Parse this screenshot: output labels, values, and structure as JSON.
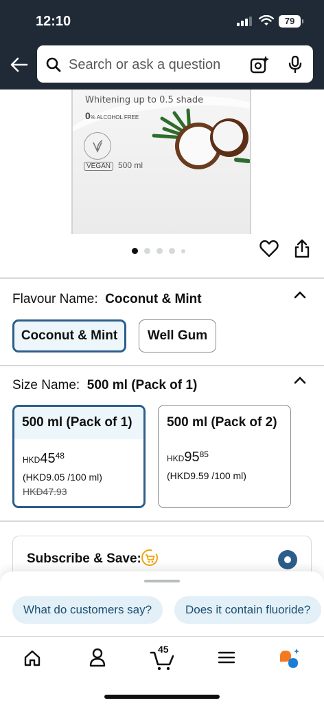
{
  "status_bar": {
    "time": "12:10",
    "battery": "79"
  },
  "search": {
    "placeholder": "Search or ask a question"
  },
  "product_image": {
    "bottle_text": "Whitening up to 0.5 shade",
    "alcohol_free_number": "0",
    "alcohol_free_label": "% ALCOHOL FREE",
    "vegan_badge": "VEGAN",
    "volume": "500 ml",
    "carousel": {
      "count": 5,
      "active_index": 0
    }
  },
  "flavour": {
    "label": "Flavour Name:",
    "selected": "Coconut & Mint",
    "options": [
      "Coconut & Mint",
      "Well Gum"
    ]
  },
  "size": {
    "label": "Size Name:",
    "selected": "500 ml (Pack of 1)",
    "options": [
      {
        "name": "500 ml (Pack of 1)",
        "currency": "HKD",
        "price_whole": "45",
        "price_fraction": "48",
        "unit_price": "(HKD9.05 /100 ml)",
        "was_price": "HKD47.93"
      },
      {
        "name": "500 ml (Pack of 2)",
        "currency": "HKD",
        "price_whole": "95",
        "price_fraction": "85",
        "unit_price": "(HKD9.59 /100 ml)"
      }
    ]
  },
  "subscribe": {
    "title": "Subscribe & Save:",
    "selected": true
  },
  "rufus": {
    "suggestions": [
      "What do customers say?",
      "Does it contain fluoride?"
    ]
  },
  "tabbar": {
    "cart_count": "45"
  },
  "colors": {
    "header_bg": "#1f2a36",
    "selected_border": "#2c5e8a",
    "selected_bg": "#edf6fb",
    "chip_bg": "#e3f0f8",
    "rufus_orange": "#f47920",
    "rufus_blue": "#1a7fd4"
  }
}
